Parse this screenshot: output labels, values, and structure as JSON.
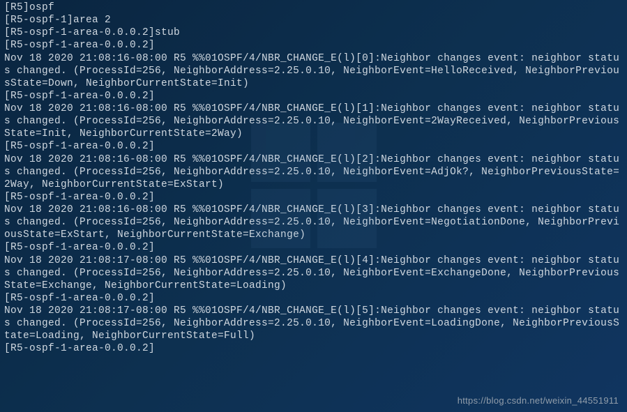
{
  "terminal": {
    "lines": [
      "[R5]ospf",
      "[R5-ospf-1]area 2",
      "[R5-ospf-1-area-0.0.0.2]stub",
      "[R5-ospf-1-area-0.0.0.2]",
      "Nov 18 2020 21:08:16-08:00 R5 %%01OSPF/4/NBR_CHANGE_E(l)[0]:Neighbor changes event: neighbor status changed. (ProcessId=256, NeighborAddress=2.25.0.10, NeighborEvent=HelloReceived, NeighborPreviousState=Down, NeighborCurrentState=Init)",
      "[R5-ospf-1-area-0.0.0.2]",
      "Nov 18 2020 21:08:16-08:00 R5 %%01OSPF/4/NBR_CHANGE_E(l)[1]:Neighbor changes event: neighbor status changed. (ProcessId=256, NeighborAddress=2.25.0.10, NeighborEvent=2WayReceived, NeighborPreviousState=Init, NeighborCurrentState=2Way)",
      "[R5-ospf-1-area-0.0.0.2]",
      "Nov 18 2020 21:08:16-08:00 R5 %%01OSPF/4/NBR_CHANGE_E(l)[2]:Neighbor changes event: neighbor status changed. (ProcessId=256, NeighborAddress=2.25.0.10, NeighborEvent=AdjOk?, NeighborPreviousState=2Way, NeighborCurrentState=ExStart)",
      "[R5-ospf-1-area-0.0.0.2]",
      "Nov 18 2020 21:08:16-08:00 R5 %%01OSPF/4/NBR_CHANGE_E(l)[3]:Neighbor changes event: neighbor status changed. (ProcessId=256, NeighborAddress=2.25.0.10, NeighborEvent=NegotiationDone, NeighborPreviousState=ExStart, NeighborCurrentState=Exchange)",
      "[R5-ospf-1-area-0.0.0.2]",
      "Nov 18 2020 21:08:17-08:00 R5 %%01OSPF/4/NBR_CHANGE_E(l)[4]:Neighbor changes event: neighbor status changed. (ProcessId=256, NeighborAddress=2.25.0.10, NeighborEvent=ExchangeDone, NeighborPreviousState=Exchange, NeighborCurrentState=Loading)",
      "[R5-ospf-1-area-0.0.0.2]",
      "Nov 18 2020 21:08:17-08:00 R5 %%01OSPF/4/NBR_CHANGE_E(l)[5]:Neighbor changes event: neighbor status changed. (ProcessId=256, NeighborAddress=2.25.0.10, NeighborEvent=LoadingDone, NeighborPreviousState=Loading, NeighborCurrentState=Full)",
      "[R5-ospf-1-area-0.0.0.2]"
    ]
  },
  "watermark": "https://blog.csdn.net/weixin_44551911"
}
